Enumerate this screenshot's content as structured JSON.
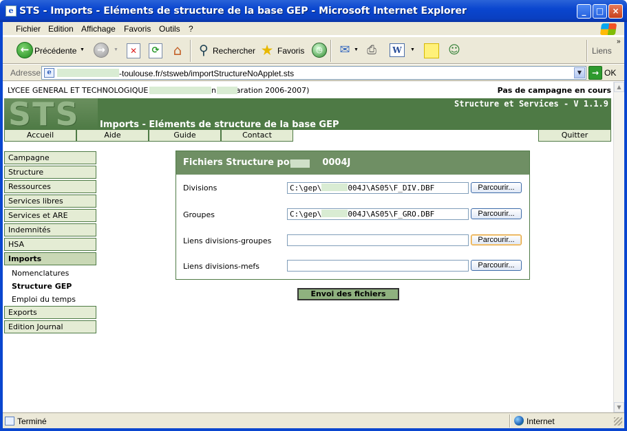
{
  "window": {
    "title": "STS - Imports - Eléments de structure de la base GEP - Microsoft Internet Explorer",
    "minimize": "_",
    "maximize": "□",
    "close": "×"
  },
  "menubar": [
    "Fichier",
    "Edition",
    "Affichage",
    "Favoris",
    "Outils",
    "?"
  ],
  "toolbar": {
    "back_label": "Précédente",
    "search_label": "Rechercher",
    "favorites_label": "Favoris",
    "links_label": "Liens",
    "arrows": "▼",
    "chevron": "»"
  },
  "addressbar": {
    "label": "Adresse",
    "url_visible": "-toulouse.fr/stsweb/importStructureNoApplet.sts",
    "go_label": "OK"
  },
  "page": {
    "school_line": "LYCEE GENERAL ET TECHNOLOGIQUE                       (          004J - Année en préparation 2006-2007)",
    "campaign_status": "Pas de campagne en cours",
    "banner_logo": "STS",
    "version": "Structure et Services - V 1.1.9",
    "banner_title": "Imports - Eléments de structure de la base GEP",
    "top_nav": [
      "Accueil",
      "Aide",
      "Guide",
      "Contact"
    ],
    "quit_label": "Quitter",
    "side_nav": [
      "Campagne",
      "Structure",
      "Ressources",
      "Services libres",
      "Services et ARE",
      "Indemnités",
      "HSA",
      "Imports"
    ],
    "imports_sub": [
      "Nomenclatures",
      "Structure GEP",
      "Emploi du temps"
    ],
    "side_nav_bottom": [
      "Exports",
      "Edition Journal"
    ],
    "panel": {
      "title_prefix": "Fichiers Structure pour",
      "title_suffix": "0004J",
      "rows": [
        {
          "label": "Divisions",
          "value_pre": "C:\\gep\\",
          "value_post": "004J\\AS05\\F_DIV.DBF",
          "button": "Parcourir..."
        },
        {
          "label": "Groupes",
          "value_pre": "C:\\gep\\",
          "value_post": "004J\\AS05\\F_GRO.DBF",
          "button": "Parcourir..."
        },
        {
          "label": "Liens divisions-groupes",
          "value_pre": "",
          "value_post": "",
          "button": "Parcourir..."
        },
        {
          "label": "Liens divisions-mefs",
          "value_pre": "",
          "value_post": "",
          "button": "Parcourir..."
        }
      ]
    },
    "submit_label": "Envoi des fichiers"
  },
  "statusbar": {
    "status": "Terminé",
    "zone": "Internet"
  },
  "colors": {
    "banner_green": "#4e7a45",
    "nav_bg": "#e4ecd4",
    "xp_blue": "#0a46cf"
  }
}
